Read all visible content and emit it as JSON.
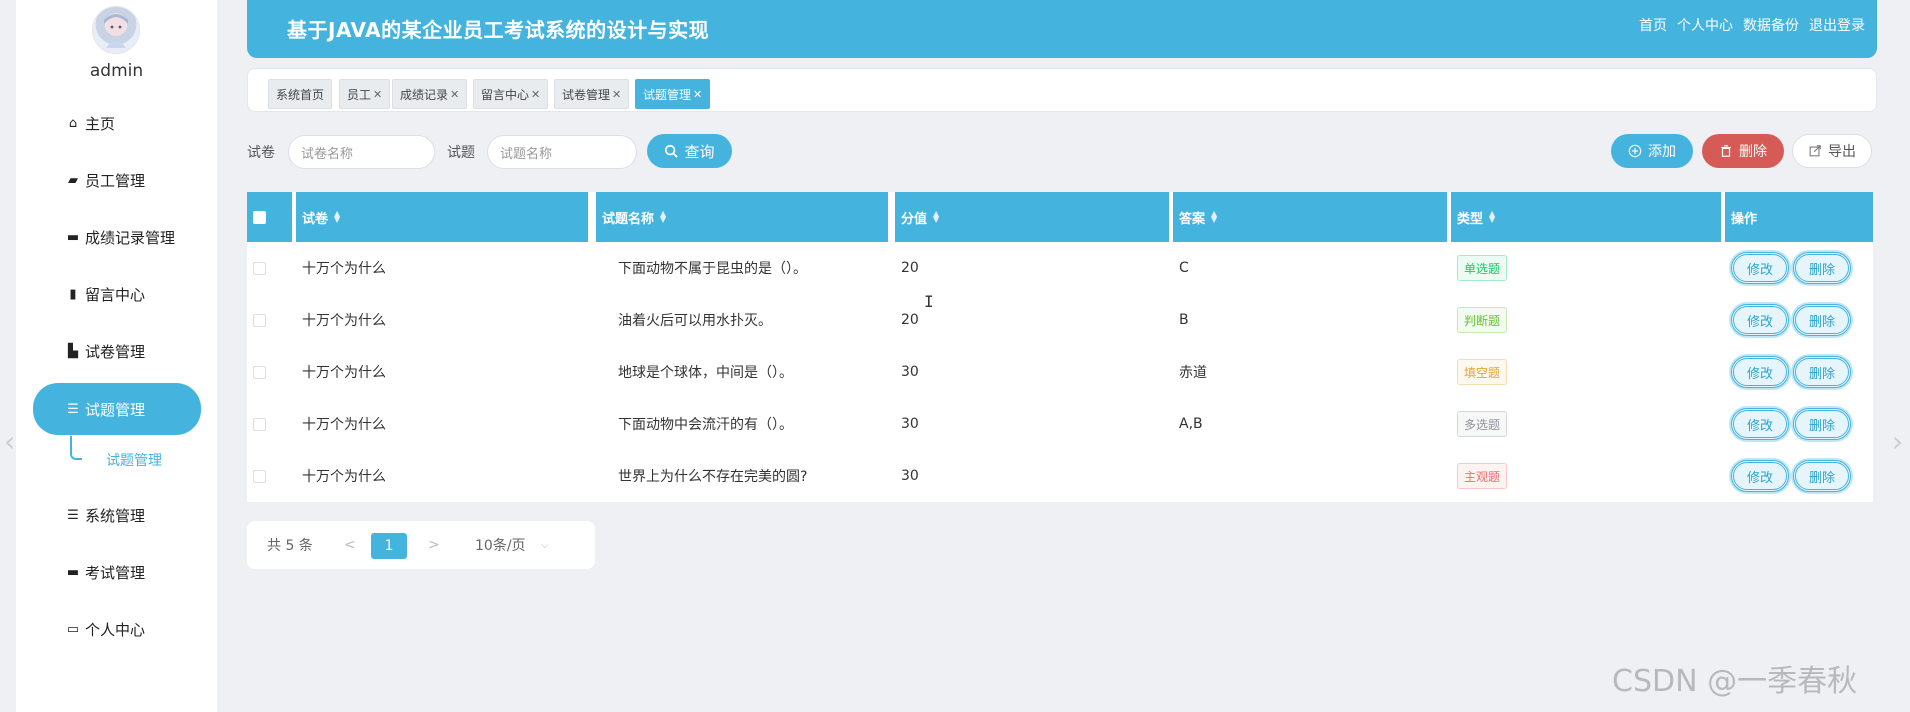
{
  "sidebar": {
    "username": "admin",
    "items": [
      {
        "label": "主页",
        "icon": "home-icon"
      },
      {
        "label": "员工管理",
        "icon": "wallet-icon"
      },
      {
        "label": "成绩记录管理",
        "icon": "monitor-icon"
      },
      {
        "label": "留言中心",
        "icon": "bar-chart-icon"
      },
      {
        "label": "试卷管理",
        "icon": "book-icon"
      },
      {
        "label": "试题管理",
        "icon": "list-icon",
        "active": true
      },
      {
        "label": "系统管理",
        "icon": "menu-icon"
      },
      {
        "label": "考试管理",
        "icon": "briefcase-icon"
      },
      {
        "label": "个人中心",
        "icon": "card-icon"
      }
    ],
    "submenu": {
      "label": "试题管理"
    }
  },
  "header": {
    "title": "基于JAVA的某企业员工考试系统的设计与实现",
    "nav": [
      "首页",
      "个人中心",
      "数据备份",
      "退出登录"
    ]
  },
  "tags": [
    {
      "label": "系统首页",
      "closable": false
    },
    {
      "label": "员工",
      "closable": true
    },
    {
      "label": "成绩记录",
      "closable": true
    },
    {
      "label": "留言中心",
      "closable": true
    },
    {
      "label": "试卷管理",
      "closable": true
    },
    {
      "label": "试题管理",
      "closable": true,
      "active": true
    }
  ],
  "search": {
    "paper_label": "试卷",
    "paper_placeholder": "试卷名称",
    "question_label": "试题",
    "question_placeholder": "试题名称",
    "query_button": "查询"
  },
  "actions": {
    "add": "添加",
    "delete": "删除",
    "export": "导出"
  },
  "table": {
    "columns": [
      "试卷",
      "试题名称",
      "分值",
      "答案",
      "类型",
      "操作"
    ],
    "rows": [
      {
        "paper": "十万个为什么",
        "question": "下面动物不属于昆虫的是（）。",
        "score": "20",
        "answer": "C",
        "type": "单选题",
        "type_color": "#13ce66"
      },
      {
        "paper": "十万个为什么",
        "question": "油着火后可以用水扑灭。",
        "score": "20",
        "answer": "B",
        "type": "判断题",
        "type_color": "#67c23a"
      },
      {
        "paper": "十万个为什么",
        "question": "地球是个球体，中间是（）。",
        "score": "30",
        "answer": "赤道",
        "type": "填空题",
        "type_color": "#e6a23c"
      },
      {
        "paper": "十万个为什么",
        "question": "下面动物中会流汗的有（）。",
        "score": "30",
        "answer": "A,B",
        "type": "多选题",
        "type_color": "#909399"
      },
      {
        "paper": "十万个为什么",
        "question": "世界上为什么不存在完美的圆?",
        "score": "30",
        "answer": "",
        "type": "主观题",
        "type_color": "#f56c6c"
      }
    ],
    "edit_label": "修改",
    "delete_label": "删除"
  },
  "pager": {
    "total": "共 5 条",
    "prev": "<",
    "page": "1",
    "next": ">",
    "size": "10条/页"
  },
  "watermark": "CSDN @一季春秋",
  "colors": {
    "accent": "#44b4df",
    "danger": "#d65b56",
    "background": "#eef0f3"
  }
}
